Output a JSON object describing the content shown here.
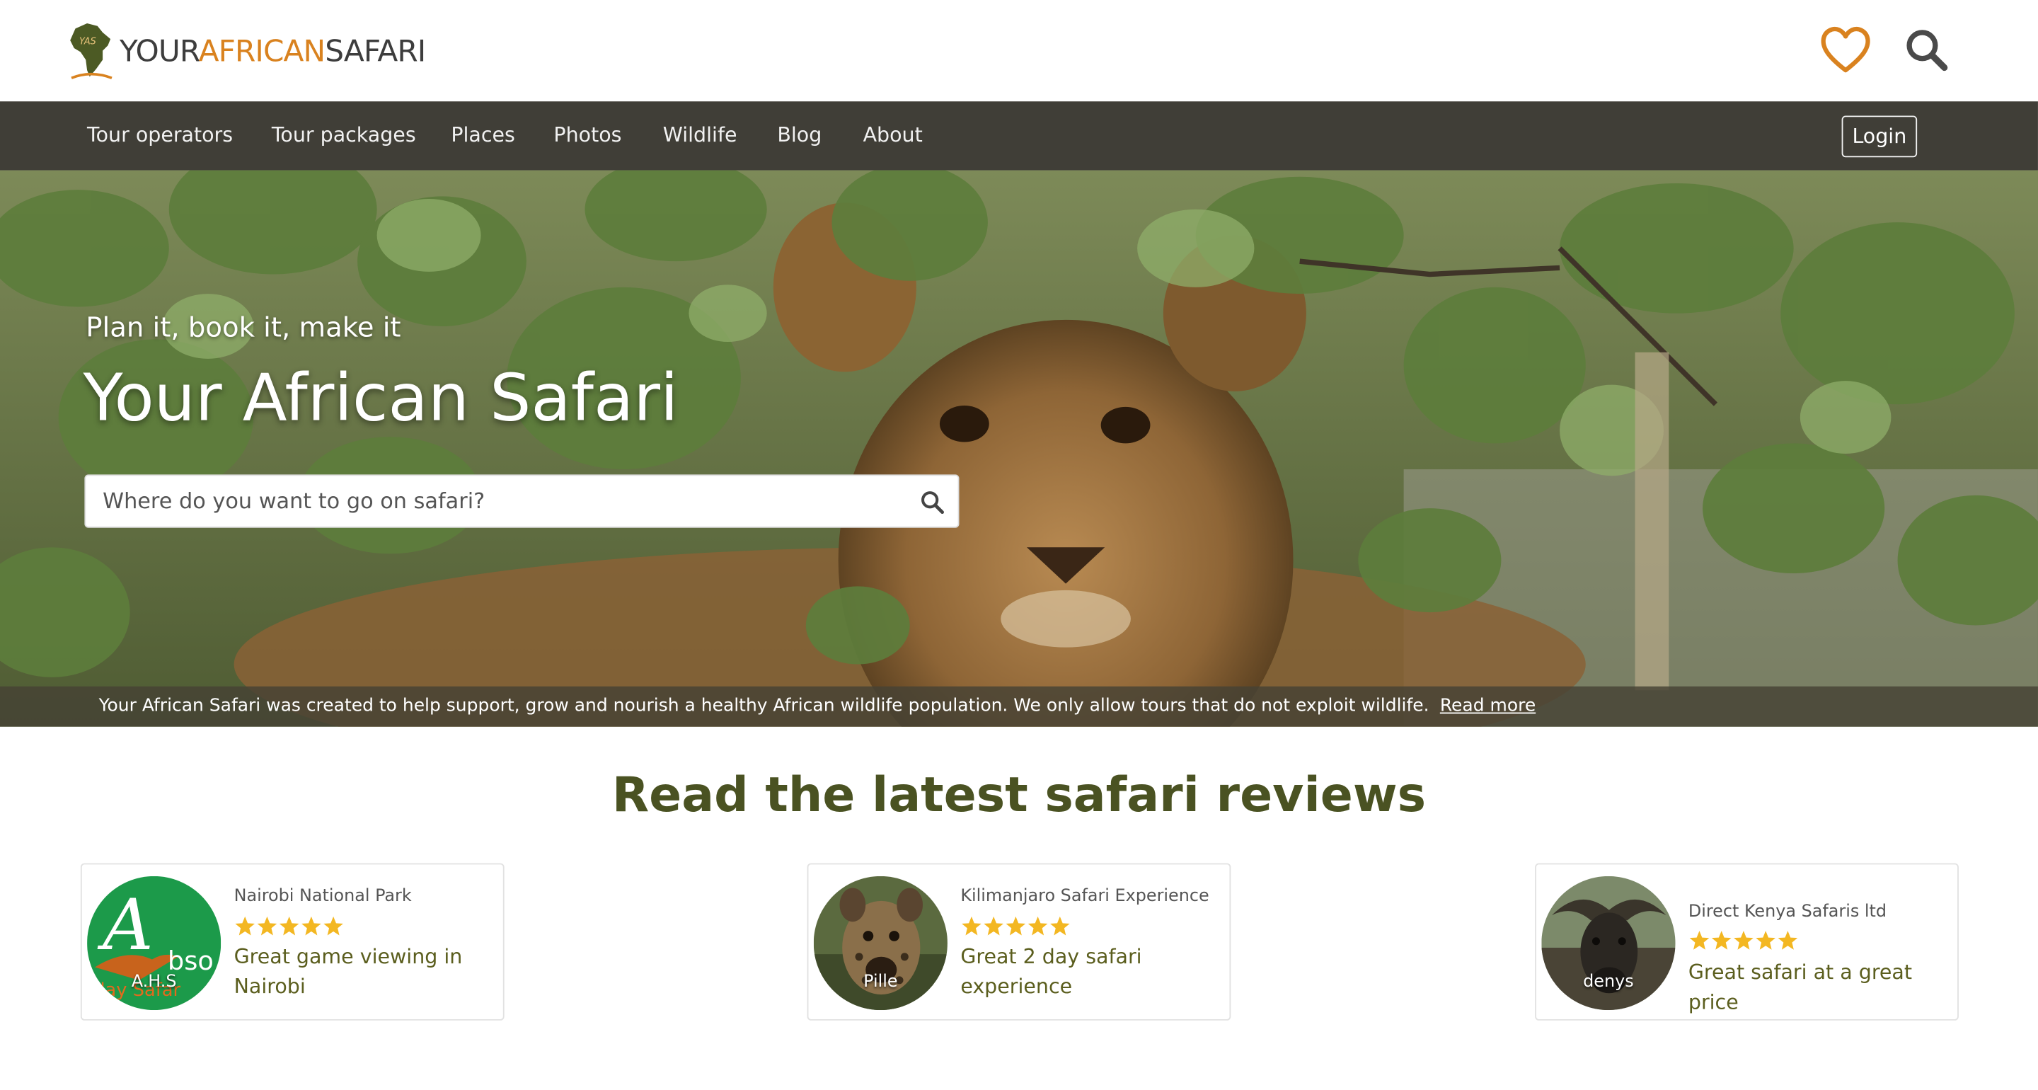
{
  "header": {
    "logo_parts": [
      "YOUR",
      "AFRICAN",
      "SAFARI"
    ],
    "logo_mark_text": "YAS"
  },
  "nav": {
    "items": [
      "Tour operators",
      "Tour packages",
      "Places",
      "Photos",
      "Wildlife",
      "Blog",
      "About"
    ],
    "login_label": "Login"
  },
  "hero": {
    "kicker": "Plan it, book it, make it",
    "title": "Your African Safari",
    "search_placeholder": "Where do you want to go on safari?",
    "mission_text": "Your African Safari was created to help support, grow and nourish a healthy African wildlife population. We only allow tours that do not exploit wildlife.",
    "read_more_label": "Read more"
  },
  "reviews": {
    "heading": "Read the latest safari reviews",
    "cards": [
      {
        "operator": "Nairobi National Park",
        "rating": 5,
        "title": "Great game viewing in Nairobi",
        "reviewer": "A.H.S"
      },
      {
        "operator": "Kilimanjaro Safari Experience",
        "rating": 5,
        "title": "Great 2 day safari experience",
        "reviewer": "Pille"
      },
      {
        "operator": "Direct Kenya Safaris ltd",
        "rating": 5,
        "title": "Great safari at a great price",
        "reviewer": "denys"
      }
    ]
  },
  "colors": {
    "nav_bg": "#403e37",
    "brand_orange": "#d9821f",
    "heading_olive": "#4a5222",
    "star_gold": "#f3b722"
  }
}
